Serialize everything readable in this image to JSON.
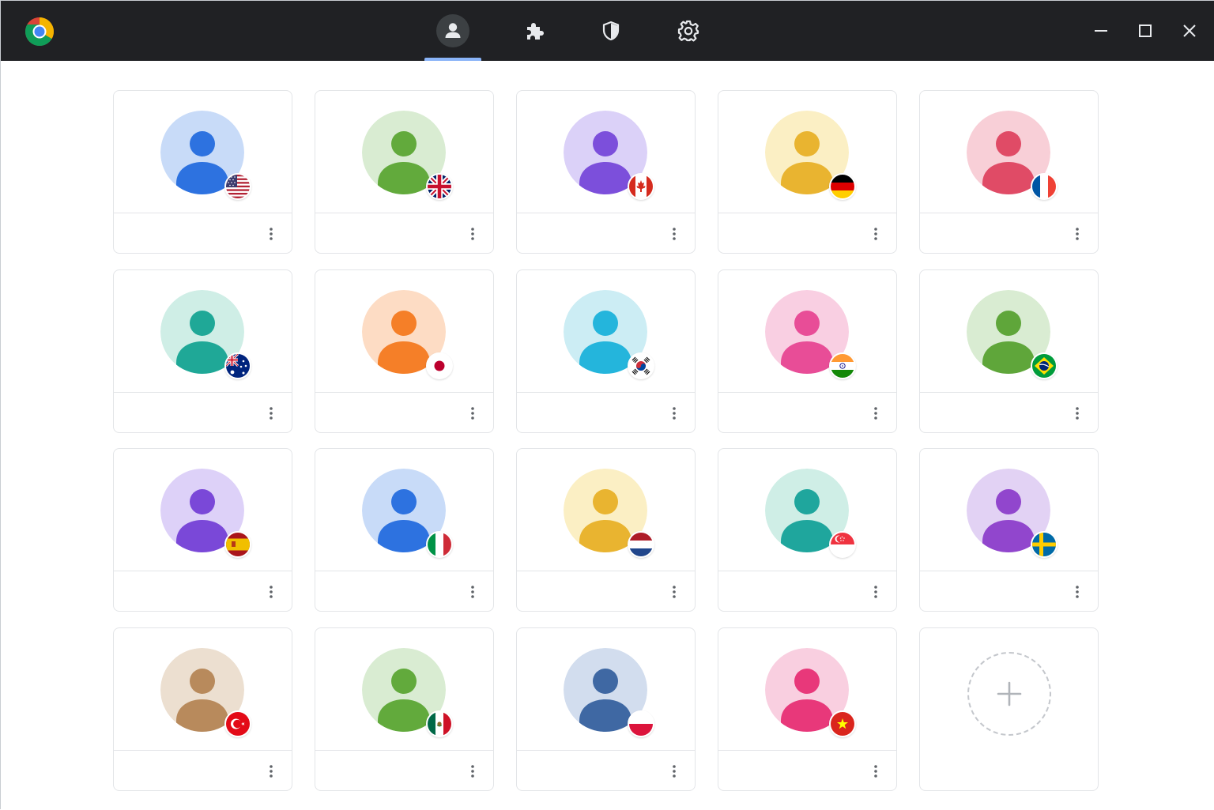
{
  "window": {
    "colors": {
      "titlebar": "#202124",
      "tab_indicator": "#8ab4f8",
      "icon": "#e8eaed"
    }
  },
  "tabs": [
    {
      "icon": "person-icon",
      "active": true
    },
    {
      "icon": "puzzle-piece-icon",
      "active": false
    },
    {
      "icon": "shield-icon",
      "active": false
    },
    {
      "icon": "gear-icon",
      "active": false
    }
  ],
  "window_controls": [
    "minimize-icon",
    "maximize-icon",
    "close-icon"
  ],
  "profiles": [
    {
      "name": "",
      "bg": "#c8dbf8",
      "fg": "#2d72e0",
      "flag": "us"
    },
    {
      "name": "",
      "bg": "#d9ecd2",
      "fg": "#62aa3c",
      "flag": "gb"
    },
    {
      "name": "",
      "bg": "#dbd1f8",
      "fg": "#7c4fdb",
      "flag": "ca"
    },
    {
      "name": "",
      "bg": "#fbefc4",
      "fg": "#e9b430",
      "flag": "de"
    },
    {
      "name": "",
      "bg": "#f8cfd7",
      "fg": "#e04b66",
      "flag": "fr"
    },
    {
      "name": "",
      "bg": "#cfeee6",
      "fg": "#1fa897",
      "flag": "au"
    },
    {
      "name": "",
      "bg": "#fddcc4",
      "fg": "#f57f28",
      "flag": "jp"
    },
    {
      "name": "",
      "bg": "#ccedf4",
      "fg": "#24b5dc",
      "flag": "kr"
    },
    {
      "name": "",
      "bg": "#f9cfe2",
      "fg": "#e84d97",
      "flag": "in"
    },
    {
      "name": "",
      "bg": "#d9ecd2",
      "fg": "#5fa63a",
      "flag": "br"
    },
    {
      "name": "",
      "bg": "#ddd1f8",
      "fg": "#7a48d8",
      "flag": "es"
    },
    {
      "name": "",
      "bg": "#c8dbf8",
      "fg": "#2d72e0",
      "flag": "it"
    },
    {
      "name": "",
      "bg": "#fbefc4",
      "fg": "#e9b430",
      "flag": "nl"
    },
    {
      "name": "",
      "bg": "#cfeee6",
      "fg": "#1fa69d",
      "flag": "sg"
    },
    {
      "name": "",
      "bg": "#e2d2f4",
      "fg": "#9146cd",
      "flag": "se"
    },
    {
      "name": "",
      "bg": "#ecdfd0",
      "fg": "#b88a5c",
      "flag": "tr"
    },
    {
      "name": "",
      "bg": "#d9ecd2",
      "fg": "#62aa3c",
      "flag": "mx"
    },
    {
      "name": "",
      "bg": "#d2ddee",
      "fg": "#3f68a3",
      "flag": "pl"
    },
    {
      "name": "",
      "bg": "#f9cfe0",
      "fg": "#e8387a",
      "flag": "vn"
    }
  ],
  "add_profile": {
    "icon": "plus-icon"
  }
}
